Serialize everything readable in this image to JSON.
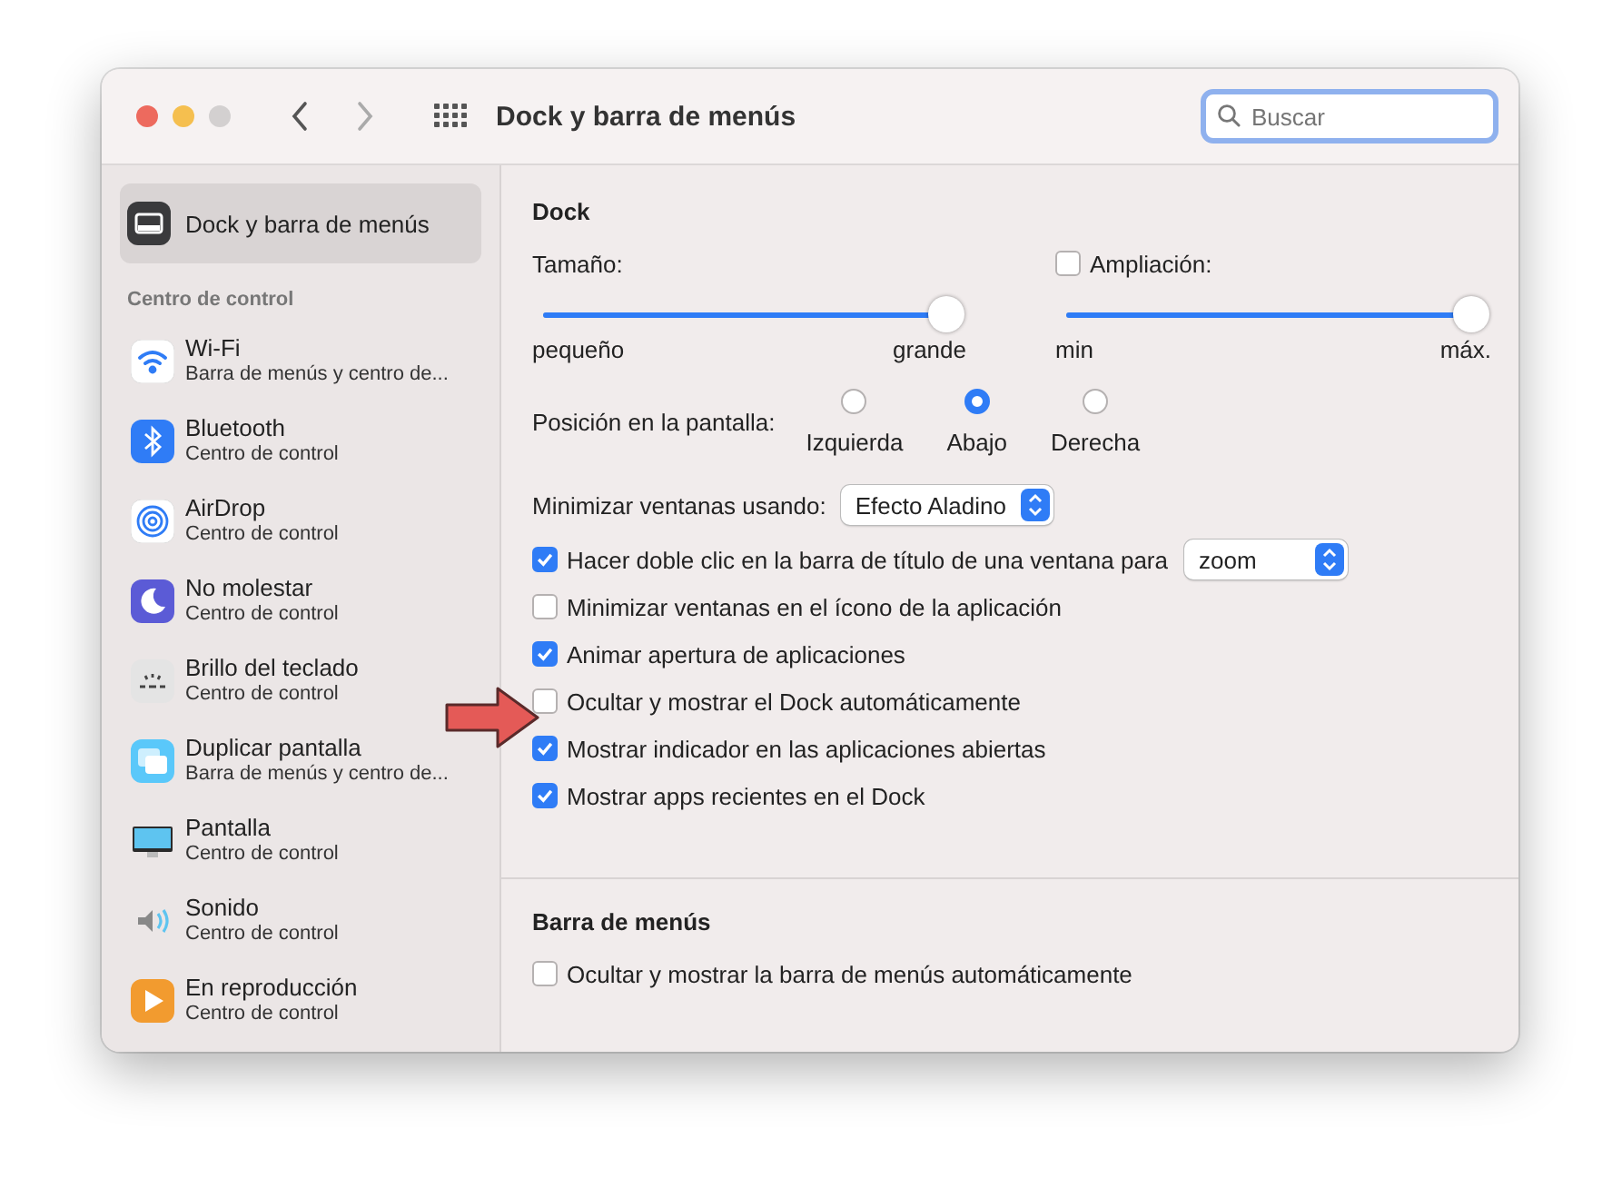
{
  "window": {
    "title": "Dock y barra de menús"
  },
  "search": {
    "placeholder": "Buscar"
  },
  "sidebar": {
    "top_item": {
      "label": "Dock y barra de menús",
      "selected": true
    },
    "section": "Centro de control",
    "items": [
      {
        "kind": "wifi",
        "label": "Wi-Fi",
        "sublabel": "Barra de menús y centro de...",
        "selected": false
      },
      {
        "kind": "bluetooth",
        "label": "Bluetooth",
        "sublabel": "Centro de control",
        "selected": false
      },
      {
        "kind": "airdrop",
        "label": "AirDrop",
        "sublabel": "Centro de control",
        "selected": false
      },
      {
        "kind": "moon",
        "label": "No molestar",
        "sublabel": "Centro de control",
        "selected": false
      },
      {
        "kind": "brightness",
        "label": "Brillo del teclado",
        "sublabel": "Centro de control",
        "selected": false
      },
      {
        "kind": "mirror",
        "label": "Duplicar pantalla",
        "sublabel": "Barra de menús y centro de...",
        "selected": false
      },
      {
        "kind": "display",
        "label": "Pantalla",
        "sublabel": "Centro de control",
        "selected": false
      },
      {
        "kind": "sound",
        "label": "Sonido",
        "sublabel": "Centro de control",
        "selected": false
      },
      {
        "kind": "play",
        "label": "En reproducción",
        "sublabel": "Centro de control",
        "selected": false
      }
    ]
  },
  "dock": {
    "heading": "Dock",
    "size": {
      "label": "Tamaño:",
      "level": 1,
      "min_label": "pequeño",
      "max_label": "grande"
    },
    "magnification": {
      "label": "Ampliación:",
      "checked": false,
      "level": 1,
      "min_label": "min",
      "max_label": "máx."
    },
    "position": {
      "label": "Posición en la pantalla:",
      "options": [
        {
          "label": "Izquierda",
          "selected": false
        },
        {
          "label": "Abajo",
          "selected": true
        },
        {
          "label": "Derecha",
          "selected": false
        }
      ]
    },
    "minimize_effect": {
      "label": "Minimizar ventanas usando:",
      "value": "Efecto Aladino"
    },
    "options": [
      {
        "label": "Hacer doble clic en la barra de título de una ventana para",
        "checked": true,
        "select_value": "zoom"
      },
      {
        "label": "Minimizar ventanas en el ícono de la aplicación",
        "checked": false
      },
      {
        "label": "Animar apertura de aplicaciones",
        "checked": true
      },
      {
        "label": "Ocultar y mostrar el Dock automáticamente",
        "checked": false
      },
      {
        "label": "Mostrar indicador en las aplicaciones abiertas",
        "checked": true
      },
      {
        "label": "Mostrar apps recientes en el Dock",
        "checked": true
      }
    ]
  },
  "menu_bar": {
    "heading": "Barra de menús",
    "options": [
      {
        "label": "Ocultar y mostrar la barra de menús automáticamente",
        "checked": false
      }
    ]
  }
}
